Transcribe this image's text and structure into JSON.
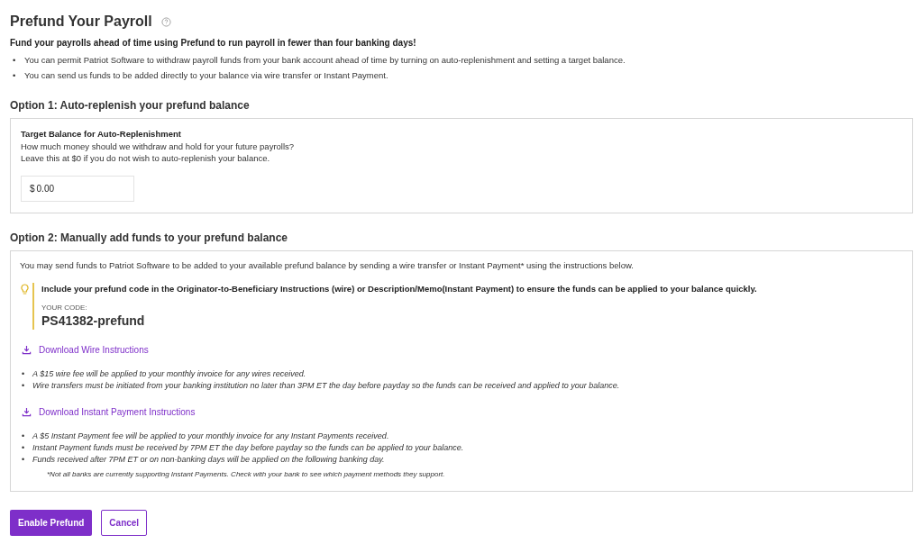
{
  "title": "Prefund Your Payroll",
  "subtitle": "Fund your payrolls ahead of time using Prefund to run payroll in fewer than four banking days!",
  "intro_bullets": [
    {
      "marker": "•",
      "text": "You can permit Patriot Software to withdraw payroll funds from your bank account ahead of time by turning on auto-replenishment and setting a target balance."
    },
    {
      "marker": "•",
      "text": "You can send us funds to be added directly to your balance via wire transfer or Instant Payment."
    }
  ],
  "option1": {
    "heading": "Option 1: Auto-replenish your prefund balance",
    "label": "Target Balance for Auto-Replenishment",
    "help": [
      "How much money should we withdraw and hold for your future payrolls?",
      "Leave this at $0 if you do not wish to auto-replenish your balance."
    ],
    "currency": "$",
    "value": "0.00"
  },
  "option2": {
    "heading": "Option 2: Manually add funds to your prefund balance",
    "intro": "You may send funds to Patriot Software to be added to your available prefund balance by sending a wire transfer or Instant Payment* using the instructions below.",
    "tip": "Include your prefund code in the Originator-to-Beneficiary Instructions (wire) or Description/Memo(Instant Payment) to ensure the funds can be applied to your balance quickly.",
    "code_label": "YOUR CODE:",
    "code": "PS41382-prefund",
    "sections": [
      {
        "link": "Download Wire Instructions",
        "bullets": [
          {
            "marker": "•",
            "text": "A $15 wire fee will be applied to your monthly invoice for any wires received."
          },
          {
            "marker": "•",
            "text": "Wire transfers must be initiated from your banking institution no later than 3PM ET the day before payday so the funds can be received and applied to your balance."
          }
        ]
      },
      {
        "link": "Download Instant Payment Instructions",
        "bullets": [
          {
            "marker": "•",
            "text": "A $5 Instant Payment fee will be applied to your monthly invoice for any Instant Payments received."
          },
          {
            "marker": "•",
            "text": "Instant Payment funds must be received by 7PM ET the day before payday so the funds can be applied to your balance."
          },
          {
            "marker": "•",
            "text": "Funds received after 7PM ET or on non-banking days will be applied on the following banking day."
          }
        ]
      }
    ],
    "footnote": "*Not all banks are currently supporting Instant Payments. Check with your bank to see which payment methods they support."
  },
  "buttons": [
    {
      "label": "Enable Prefund",
      "kind": "primary"
    },
    {
      "label": "Cancel",
      "kind": "secondary"
    }
  ]
}
